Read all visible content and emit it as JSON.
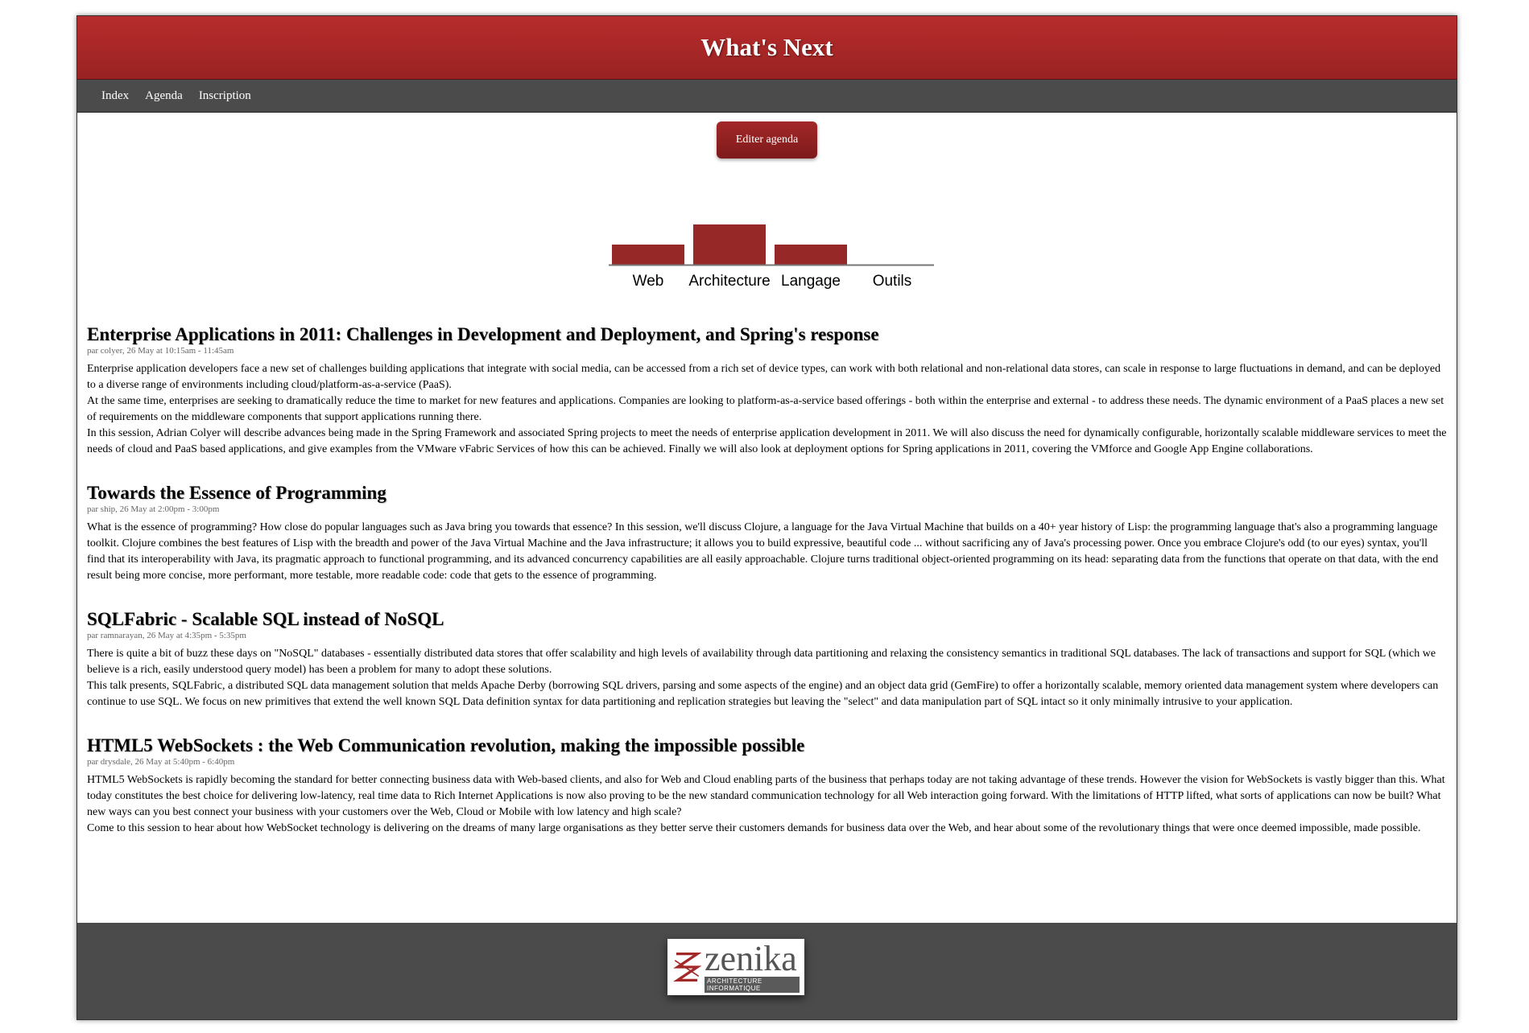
{
  "header": {
    "title": "What's Next"
  },
  "nav": {
    "items": [
      "Index",
      "Agenda",
      "Inscription"
    ]
  },
  "toolbar": {
    "edit_label": "Editer agenda"
  },
  "chart_data": {
    "type": "bar",
    "categories": [
      "Web",
      "Architecture",
      "Langage",
      "Outils"
    ],
    "values": [
      1,
      2,
      1,
      0
    ],
    "ylim": [
      0,
      2
    ],
    "color": "#962828",
    "grid": false
  },
  "talks": [
    {
      "title": "Enterprise Applications in 2011: Challenges in Development and Deployment, and Spring's response",
      "meta": "par colyer, 26 May at 10:15am - 11:45am",
      "paragraphs": [
        "Enterprise application developers face a new set of challenges building applications that integrate with social media, can be accessed from a rich set of device types, can work with both relational and non-relational data stores, can scale in response to large fluctuations in demand, and can be deployed to a diverse range of environments including cloud/platform-as-a-service (PaaS).",
        "At the same time, enterprises are seeking to dramatically reduce the time to market for new features and applications. Companies are looking to platform-as-a-service based offerings - both within the enterprise and external - to address these needs. The dynamic environment of a PaaS places a new set of requirements on the middleware components that support applications running there.",
        "In this session, Adrian Colyer will describe advances being made in the Spring Framework and associated Spring projects to meet the needs of enterprise application development in 2011. We will also discuss the need for dynamically configurable, horizontally scalable middleware services to meet the needs of cloud and PaaS based applications, and give examples from the VMware vFabric Services of how this can be achieved. Finally we will also look at deployment options for Spring applications in 2011, covering the VMforce and Google App Engine collaborations."
      ]
    },
    {
      "title": "Towards the Essence of Programming",
      "meta": "par ship, 26 May at 2:00pm - 3:00pm",
      "paragraphs": [
        "What is the essence of programming? How close do popular languages such as Java bring you towards that essence? In this session, we'll discuss Clojure, a language for the Java Virtual Machine that builds on a 40+ year history of Lisp: the programming language that's also a programming language toolkit. Clojure combines the best features of Lisp with the breadth and power of the Java Virtual Machine and the Java infrastructure; it allows you to build expressive, beautiful code ... without sacrificing any of Java's processing power. Once you embrace Clojure's odd (to our eyes) syntax, you'll find that its interoperability with Java, its pragmatic approach to functional programming, and its advanced concurrency capabilities are all easily approachable. Clojure turns traditional object-oriented programming on its head: separating data from the functions that operate on that data, with the end result being more concise, more performant, more testable, more readable code: code that gets to the essence of programming."
      ]
    },
    {
      "title": "SQLFabric - Scalable SQL instead of NoSQL",
      "meta": "par ramnarayan, 26 May at 4:35pm - 5:35pm",
      "paragraphs": [
        "There is quite a bit of buzz these days on \"NoSQL\" databases - essentially distributed data stores that offer scalability and high levels of availability through data partitioning and relaxing the consistency semantics in traditional SQL databases. The lack of transactions and support for SQL (which we believe is a rich, easily understood query model) has been a problem for many to adopt these solutions.",
        "This talk presents, SQLFabric, a distributed SQL data management solution that melds Apache Derby (borrowing SQL drivers, parsing and some aspects of the engine) and an object data grid (GemFire) to offer a horizontally scalable, memory oriented data management system where developers can continue to use SQL. We focus on new primitives that extend the well known SQL Data definition syntax for data partitioning and replication strategies but leaving the \"select\" and data manipulation part of SQL intact so it only minimally intrusive to your application."
      ]
    },
    {
      "title": "HTML5 WebSockets : the Web Communication revolution, making the impossible possible",
      "meta": "par drysdale, 26 May at 5:40pm - 6:40pm",
      "paragraphs": [
        "HTML5 WebSockets is rapidly becoming the standard for better connecting business data with Web-based clients, and also for Web and Cloud enabling parts of the business that perhaps today are not taking advantage of these trends. However the vision for WebSockets is vastly bigger than this. What today constitutes the best choice for delivering low-latency, real time data to Rich Internet Applications is now also proving to be the new standard communication technology for all Web interaction going forward. With the limitations of HTTP lifted, what sorts of applications can now be built? What new ways can you best connect your business with your customers over the Web, Cloud or Mobile with low latency and high scale?",
        "Come to this session to hear about how WebSocket technology is delivering on the dreams of many large organisations as they better serve their customers demands for business data over the Web, and hear about some of the revolutionary things that were once deemed impossible, made possible."
      ]
    }
  ],
  "footer": {
    "logo_brand": "zenika",
    "logo_sub": "ARCHITECTURE INFORMATIQUE",
    "logo_icon": "zenika-logo-mark-icon"
  }
}
